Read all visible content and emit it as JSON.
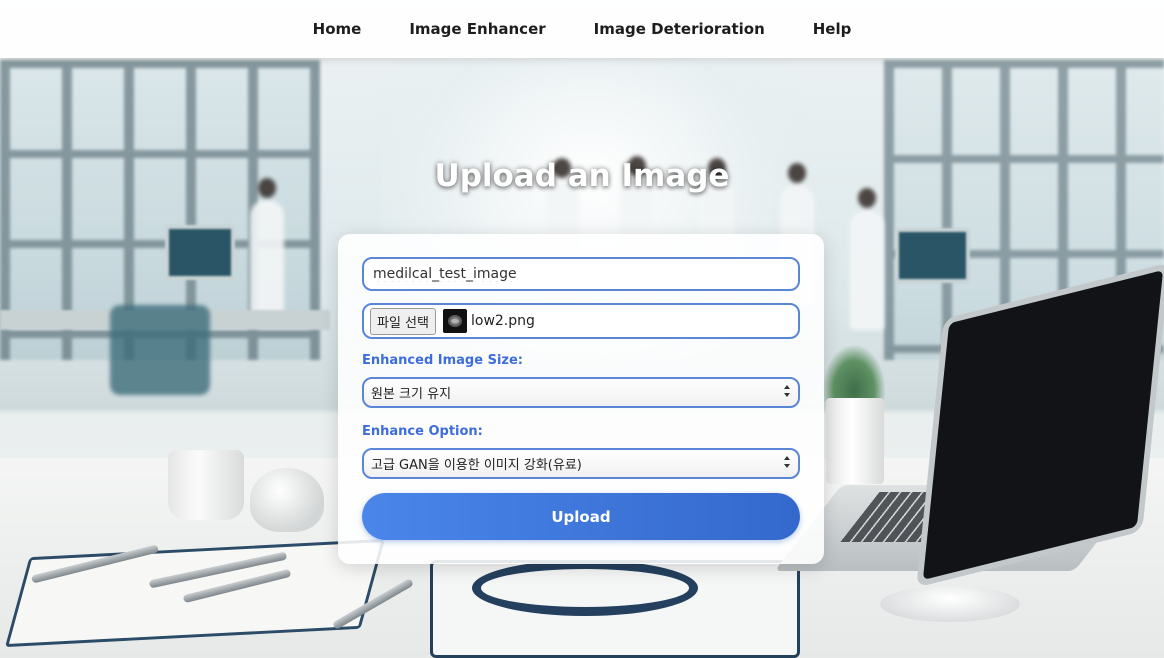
{
  "nav": {
    "items": [
      {
        "label": "Home"
      },
      {
        "label": "Image Enhancer"
      },
      {
        "label": "Image Deterioration"
      },
      {
        "label": "Help"
      }
    ]
  },
  "main": {
    "title": "Upload an Image"
  },
  "form": {
    "image_name_value": "medilcal_test_image",
    "file": {
      "button_label": "파일 선택",
      "file_name": "low2.png"
    },
    "size": {
      "label": "Enhanced Image Size:",
      "selected": "원본 크기 유지"
    },
    "option": {
      "label": "Enhance Option:",
      "selected": "고급 GAN을 이용한 이미지 강화(유료)"
    },
    "upload_label": "Upload"
  },
  "colors": {
    "accent": "#3d6ddb",
    "button_start": "#4a86ea",
    "button_end": "#3468cc",
    "field_border": "#5a86d8"
  }
}
